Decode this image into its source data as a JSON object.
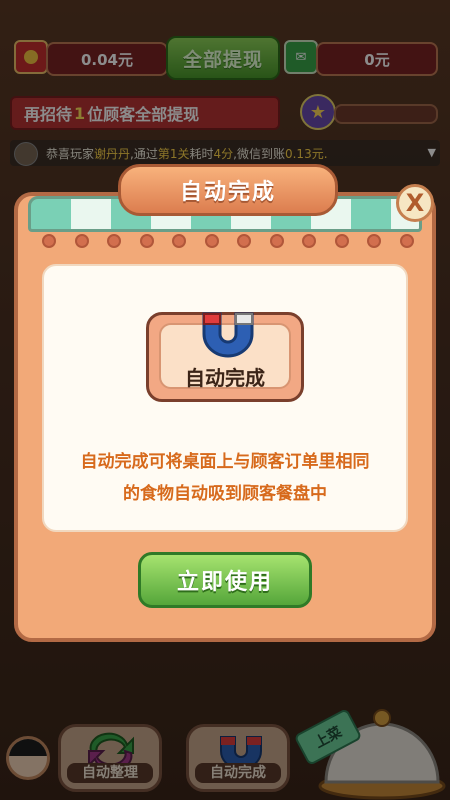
{
  "hud": {
    "money_value": "0.04元",
    "withdraw_all_label": "全部提现",
    "wallet_value": "0元",
    "coin_icon": "coin-icon",
    "wechat_icon": "wechat-icon"
  },
  "task": {
    "prefix": "再招待",
    "count": "1",
    "suffix": "位顾客全部提现",
    "progress_fraction": 0.0
  },
  "ticker": {
    "text_1": "恭喜玩家",
    "player": "谢丹丹",
    "text_2": ",通过",
    "level": "第1关",
    "text_3": "耗时",
    "time": "4分",
    "text_4": ",微信到账",
    "amount": "0.13元."
  },
  "modal": {
    "title": "自动完成",
    "close_label": "X",
    "item_label": "自动完成",
    "description_line_1": "自动完成可将桌面上与顾客订单里相同",
    "description_line_2": "的食物自动吸到顾客餐盘中",
    "use_button_label": "立即使用",
    "colors": {
      "accent_orange": "#d76a1c",
      "button_green": "#55a63a",
      "frame": "#f2a978"
    }
  },
  "toolbar": {
    "auto_sort_label": "自动整理",
    "auto_complete_label": "自动完成",
    "serve_label": "上菜"
  }
}
